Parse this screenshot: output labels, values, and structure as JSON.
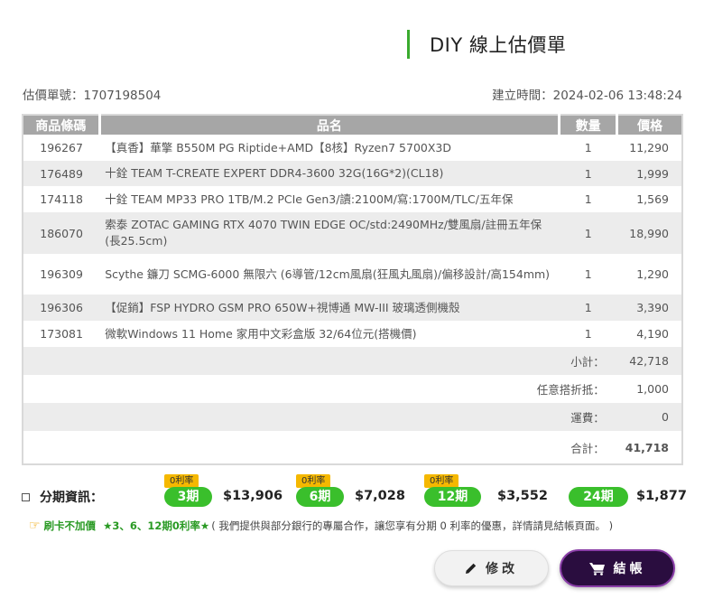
{
  "header": {
    "title": "DIY 線上估價單"
  },
  "meta": {
    "quote_no": "估價單號：1707198504",
    "created": "建立時間：2024-02-06 13:48:24"
  },
  "table": {
    "headers": {
      "code": "商品條碼",
      "name": "品名",
      "qty": "數量",
      "price": "價格"
    },
    "rows": [
      {
        "code": "196267",
        "name": "【真香】華擎 B550M PG Riptide+AMD【8核】Ryzen7 5700X3D",
        "qty": "1",
        "price": "11,290"
      },
      {
        "code": "176489",
        "name": "十銓 TEAM T-CREATE EXPERT DDR4-3600 32G(16G*2)(CL18)",
        "qty": "1",
        "price": "1,999"
      },
      {
        "code": "174118",
        "name": "十銓 TEAM MP33 PRO 1TB/M.2 PCIe Gen3/讀:2100M/寫:1700M/TLC/五年保",
        "qty": "1",
        "price": "1,569"
      },
      {
        "code": "186070",
        "name": "索泰 ZOTAC GAMING RTX 4070 TWIN EDGE OC/std:2490MHz/雙風扇/註冊五年保(長25.5cm)",
        "qty": "1",
        "price": "18,990"
      },
      {
        "code": "196309",
        "name": "Scythe 鐮刀 SCMG-6000 無限六 (6導管/12cm風扇(狂風丸風扇)/偏移設計/高154mm)",
        "qty": "1",
        "price": "1,290"
      },
      {
        "code": "196306",
        "name": "【促銷】FSP HYDRO GSM PRO 650W+視博通 MW-III 玻璃透側機殼",
        "qty": "1",
        "price": "3,390"
      },
      {
        "code": "173081",
        "name": "微軟Windows 11 Home 家用中文彩盒版 32/64位元(搭機價)",
        "qty": "1",
        "price": "4,190"
      }
    ],
    "summary": {
      "subtotal_label": "小計：",
      "subtotal": "42,718",
      "discount_label": "任意搭折抵：",
      "discount": "1,000",
      "shipping_label": "運費：",
      "shipping": "0",
      "total_label": "合計：",
      "total": "41,718"
    }
  },
  "installments": {
    "label": "分期資訊：",
    "zero_interest": "0利率",
    "plans": [
      {
        "term": "3期",
        "amount": "$13,906",
        "zero": true
      },
      {
        "term": "6期",
        "amount": "$7,028",
        "zero": true
      },
      {
        "term": "12期",
        "amount": "$3,552",
        "zero": true
      },
      {
        "term": "24期",
        "amount": "$1,877",
        "zero": false
      }
    ]
  },
  "promo": {
    "no_surcharge": "刷卡不加價",
    "highlight": "★3、6、12期0利率★",
    "note": "( 我們提供與部分銀行的專屬合作，讓您享有分期 0 利率的優惠，詳情請見結帳頁面。 )"
  },
  "buttons": {
    "edit": "修改",
    "checkout": "結帳"
  },
  "colors": {
    "accent_green": "#3abf2c",
    "price_red": "#e41b17",
    "checkout_bg": "#2a0d3f",
    "badge_yellow": "#f5b800"
  }
}
